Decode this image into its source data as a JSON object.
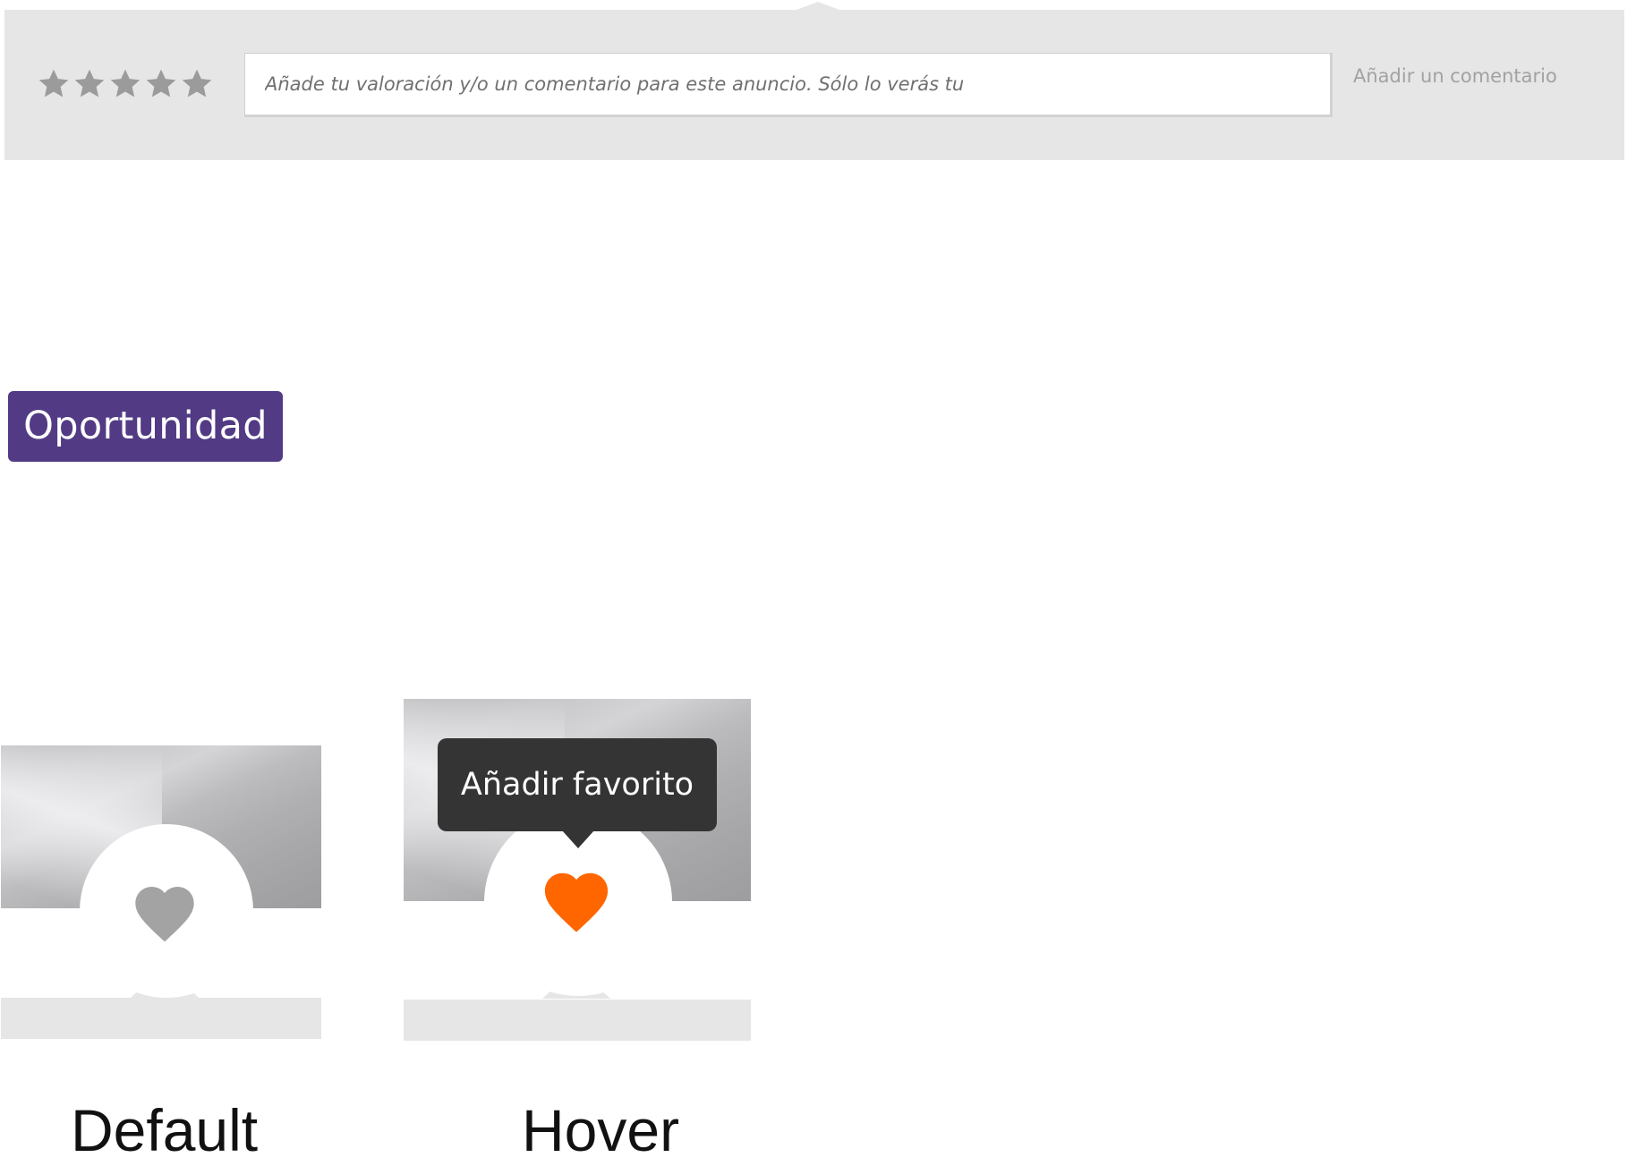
{
  "comment_bar": {
    "rating_stars": 5,
    "star_color": "#9b9b9b",
    "input_placeholder": "Añade tu valoración y/o un comentario para este anuncio. Sólo lo verás tu",
    "input_value": "",
    "add_comment_label": "Añadir un comentario",
    "background_color": "#e6e6e6"
  },
  "badge": {
    "label": "Oportunidad",
    "background_color": "#523a84",
    "text_color": "#ffffff"
  },
  "favorite_states": {
    "default": {
      "caption": "Default",
      "heart_icon": "heart-icon",
      "heart_color": "#a3a3a3"
    },
    "hover": {
      "caption": "Hover",
      "heart_icon": "heart-icon",
      "heart_color": "#ff6600",
      "tooltip": "Añadir favorito",
      "tooltip_background": "#343434"
    }
  }
}
